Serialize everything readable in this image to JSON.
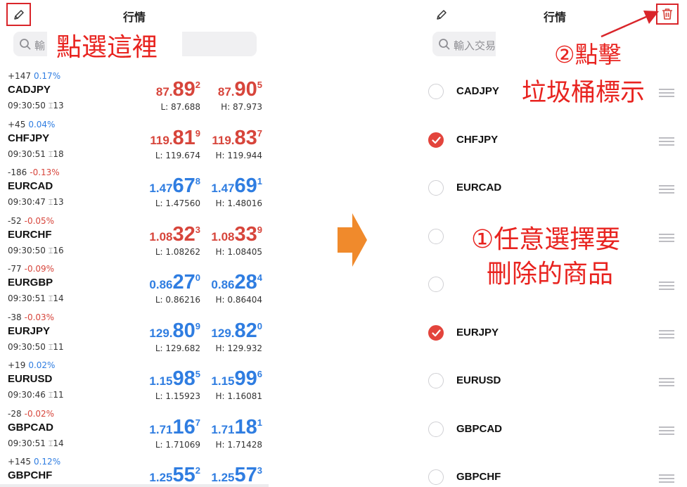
{
  "left": {
    "title": "行情",
    "search_placeholder": "輸",
    "annotation": "點選這裡",
    "quotes": [
      {
        "change": "+147",
        "pct": "0.17%",
        "symbol": "CADJPY",
        "time": "09:30:50",
        "spread": "13",
        "color": "red",
        "bid": {
          "a": "87.",
          "b": "89",
          "c": "2"
        },
        "ask": {
          "a": "87.",
          "b": "90",
          "c": "5"
        },
        "low": "L: 87.688",
        "high": "H: 87.973"
      },
      {
        "change": "+45",
        "pct": "0.04%",
        "symbol": "CHFJPY",
        "time": "09:30:51",
        "spread": "18",
        "color": "red",
        "bid": {
          "a": "119.",
          "b": "81",
          "c": "9"
        },
        "ask": {
          "a": "119.",
          "b": "83",
          "c": "7"
        },
        "low": "L: 119.674",
        "high": "H: 119.944"
      },
      {
        "change": "-186",
        "pct": "-0.13%",
        "symbol": "EURCAD",
        "time": "09:30:47",
        "spread": "13",
        "color": "blue",
        "bid": {
          "a": "1.47",
          "b": "67",
          "c": "8"
        },
        "ask": {
          "a": "1.47",
          "b": "69",
          "c": "1"
        },
        "low": "L: 1.47560",
        "high": "H: 1.48016"
      },
      {
        "change": "-52",
        "pct": "-0.05%",
        "symbol": "EURCHF",
        "time": "09:30:50",
        "spread": "16",
        "color": "red",
        "bid": {
          "a": "1.08",
          "b": "32",
          "c": "3"
        },
        "ask": {
          "a": "1.08",
          "b": "33",
          "c": "9"
        },
        "low": "L: 1.08262",
        "high": "H: 1.08405"
      },
      {
        "change": "-77",
        "pct": "-0.09%",
        "symbol": "EURGBP",
        "time": "09:30:51",
        "spread": "14",
        "color": "blue",
        "bid": {
          "a": "0.86",
          "b": "27",
          "c": "0"
        },
        "ask": {
          "a": "0.86",
          "b": "28",
          "c": "4"
        },
        "low": "L: 0.86216",
        "high": "H: 0.86404"
      },
      {
        "change": "-38",
        "pct": "-0.03%",
        "symbol": "EURJPY",
        "time": "09:30:50",
        "spread": "11",
        "color": "blue",
        "bid": {
          "a": "129.",
          "b": "80",
          "c": "9"
        },
        "ask": {
          "a": "129.",
          "b": "82",
          "c": "0"
        },
        "low": "L: 129.682",
        "high": "H: 129.932"
      },
      {
        "change": "+19",
        "pct": "0.02%",
        "symbol": "EURUSD",
        "time": "09:30:46",
        "spread": "11",
        "color": "blue",
        "bid": {
          "a": "1.15",
          "b": "98",
          "c": "5"
        },
        "ask": {
          "a": "1.15",
          "b": "99",
          "c": "6"
        },
        "low": "L: 1.15923",
        "high": "H: 1.16081"
      },
      {
        "change": "-28",
        "pct": "-0.02%",
        "symbol": "GBPCAD",
        "time": "09:30:51",
        "spread": "14",
        "color": "blue",
        "bid": {
          "a": "1.71",
          "b": "16",
          "c": "7"
        },
        "ask": {
          "a": "1.71",
          "b": "18",
          "c": "1"
        },
        "low": "L: 1.71069",
        "high": "H: 1.71428"
      },
      {
        "change": "+145",
        "pct": "0.12%",
        "symbol": "GBPCHF",
        "time": "",
        "spread": "",
        "color": "blue",
        "bid": {
          "a": "1.25",
          "b": "55",
          "c": "2"
        },
        "ask": {
          "a": "1.25",
          "b": "57",
          "c": "3"
        },
        "low": "",
        "high": ""
      }
    ]
  },
  "right": {
    "title": "行情",
    "search_placeholder": "輸入交易",
    "annotation_step2_line1": "②點擊",
    "annotation_step2_line2": "垃圾桶標示",
    "annotation_step1_line1": "①任意選擇要",
    "annotation_step1_line2": "刪除的商品",
    "items": [
      {
        "symbol": "CADJPY",
        "checked": false,
        "handle": true
      },
      {
        "symbol": "CHFJPY",
        "checked": true,
        "handle": true
      },
      {
        "symbol": "EURCAD",
        "checked": false,
        "handle": true
      },
      {
        "symbol": "",
        "checked": false,
        "handle": true
      },
      {
        "symbol": "",
        "checked": false,
        "handle": true
      },
      {
        "symbol": "EURJPY",
        "checked": true,
        "handle": true
      },
      {
        "symbol": "EURUSD",
        "checked": false,
        "handle": true
      },
      {
        "symbol": "GBPCAD",
        "checked": false,
        "handle": true
      },
      {
        "symbol": "GBPCHF",
        "checked": false,
        "handle": true
      }
    ]
  },
  "colors": {
    "up": "#d7453b",
    "down": "#2f7de1",
    "annotation": "#e8231f",
    "arrow": "#f08a2c",
    "check": "#e3443c"
  }
}
